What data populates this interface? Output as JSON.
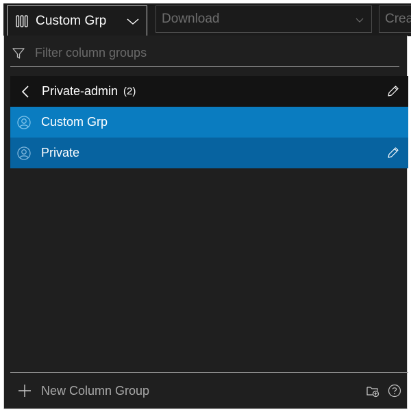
{
  "toolbar": {
    "column_group_button": {
      "label": "Custom Grp",
      "icon": "columns-icon"
    },
    "download_select": {
      "value": "Download",
      "icon": "chevron-down-icon"
    },
    "create_button": {
      "label": "Crea"
    }
  },
  "panel": {
    "filter": {
      "placeholder": "Filter column groups",
      "value": "",
      "icon": "filter-icon"
    },
    "back_row": {
      "name": "Private-admin",
      "count": "(2)",
      "icons": [
        "chevron-left-icon",
        "pencil-icon"
      ]
    },
    "items": [
      {
        "name": "Custom Grp",
        "icon": "user-circle-icon",
        "selected": true
      },
      {
        "name": "Private",
        "icon": "user-circle-icon",
        "hovered": true,
        "editable": true
      }
    ],
    "footer": {
      "new_label": "New Column Group",
      "icons": [
        "plus-icon",
        "folder-add-icon",
        "help-icon"
      ]
    }
  },
  "colors": {
    "background": "#1f1f1f",
    "selected": "#0a7cc0",
    "hover": "#0763a0",
    "header_row": "#131313"
  }
}
